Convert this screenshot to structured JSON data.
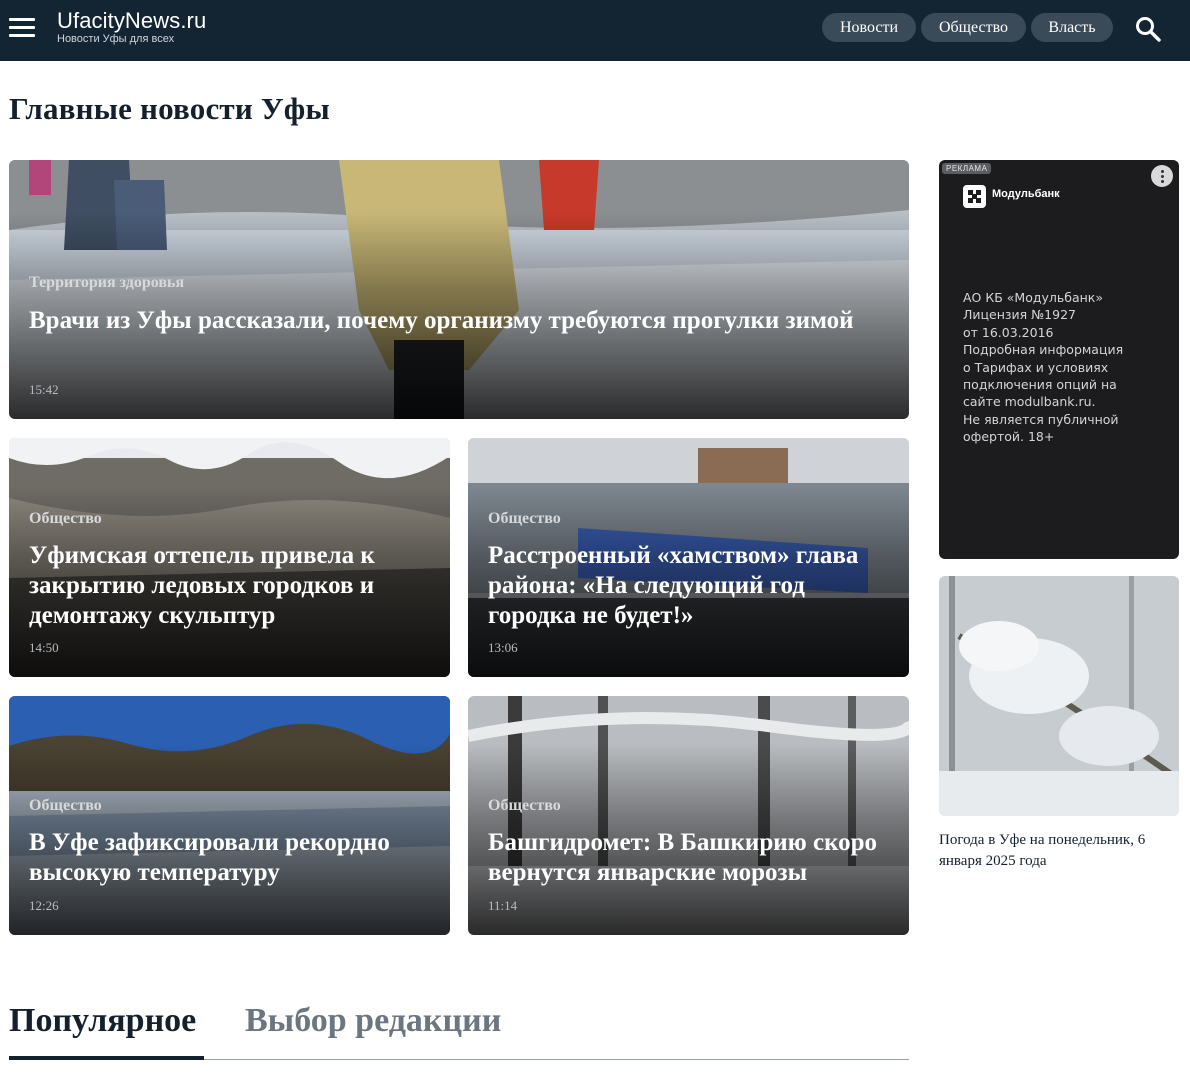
{
  "header": {
    "logo": "UfacityNews.ru",
    "slogan": "Новости Уфы для всех",
    "nav": [
      "Новости",
      "Общество",
      "Власть"
    ]
  },
  "page_title": "Главные новости Уфы",
  "articles": [
    {
      "category": "Территория здоровья",
      "title": "Врачи из Уфы рассказали, почему организму требуются прогулки зимой",
      "time": "15:42"
    },
    {
      "category": "Общество",
      "title": "Уфимская оттепель привела к закрытию ледовых городков и демонтажу скульптур",
      "time": "14:50"
    },
    {
      "category": "Общество",
      "title": "Расстроенный «хамством» глава района: «На следующий год городка не будет!»",
      "time": "13:06"
    },
    {
      "category": "Общество",
      "title": "В Уфе зафиксировали рекордно высокую температуру",
      "time": "12:26"
    },
    {
      "category": "Общество",
      "title": "Башгидромет: В Башкирию скоро вернутся январские морозы",
      "time": "11:14"
    }
  ],
  "ad": {
    "label": "РЕКЛАМА",
    "brand": "Модульбанк",
    "lines": [
      "АО КБ «Модульбанк»",
      "Лицензия №1927",
      "от 16.03.2016",
      "Подробная информация",
      "о Тарифах и условиях",
      "подключения опций на",
      "сайте modulbank.ru.",
      "Не является публичной",
      "офертой. 18+"
    ]
  },
  "sidebar": {
    "caption": "Погода в Уфе на понедельник, 6 января 2025 года"
  },
  "tabs": {
    "active": "Популярное",
    "inactive": "Выбор редакции"
  }
}
